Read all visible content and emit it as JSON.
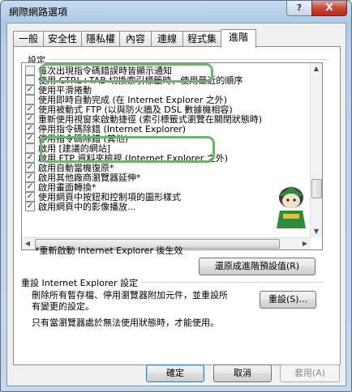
{
  "window": {
    "title": "網際網路選項",
    "help_glyph": "?",
    "close_glyph": "X"
  },
  "tabs": [
    {
      "label": "一般"
    },
    {
      "label": "安全性"
    },
    {
      "label": "隱私權"
    },
    {
      "label": "內容"
    },
    {
      "label": "連線"
    },
    {
      "label": "程式集"
    },
    {
      "label": "進階",
      "active": true
    }
  ],
  "settings": {
    "group_label": "設定",
    "items": [
      {
        "label": "每次出現指令碼錯誤時皆顯示通知",
        "checked": false
      },
      {
        "label": "使用 CTRL+TAB 切換索引標籤時，使用最近的順序",
        "checked": false
      },
      {
        "label": "使用平滑捲動",
        "checked": true
      },
      {
        "label": "使用即時自動完成 (在 Internet Explorer 之外)",
        "checked": false
      },
      {
        "label": "使用被動式 FTP (以與防火牆及 DSL 數據機相容)",
        "checked": true
      },
      {
        "label": "重新使用視窗來啟動捷徑 (索引標籤式瀏覽在關閉狀態時)",
        "checked": true
      },
      {
        "label": "停用指令碼除錯 (Internet Explorer)",
        "checked": true
      },
      {
        "label": "停用指令碼除錯 (其他)",
        "checked": true
      },
      {
        "label": "啟用 [建議的網站]",
        "checked": false
      },
      {
        "label": "啟用 FTP 資料夾檢視 (Internet Explorer 之外)",
        "checked": true
      },
      {
        "label": "啟用自動當機復原*",
        "checked": true
      },
      {
        "label": "啟用其他廠商瀏覽器延伸*",
        "checked": true
      },
      {
        "label": "啟用畫面轉換*",
        "checked": true
      },
      {
        "label": "使用網頁中按鈕和控制項的圖形樣式",
        "checked": true
      },
      {
        "label": "啟用網頁中的影像播放...",
        "checked": true
      }
    ],
    "check_glyph": "✓",
    "restart_note": "*重新啟動 Internet Explorer 後生效",
    "restore_button": "還原成進階預設值(R)"
  },
  "reset": {
    "group_label": "重設 Internet Explorer 設定",
    "description_line1": "刪除所有暫存檔、停用瀏覽器附加元件，並重設所",
    "description_line2": "有變更的設定。",
    "reset_button": "重設(S)...",
    "note": "只有當瀏覽器處於無法使用狀態時，才能使用。"
  },
  "footer": {
    "ok": "確定",
    "cancel": "取消",
    "apply": "套用(A)"
  }
}
